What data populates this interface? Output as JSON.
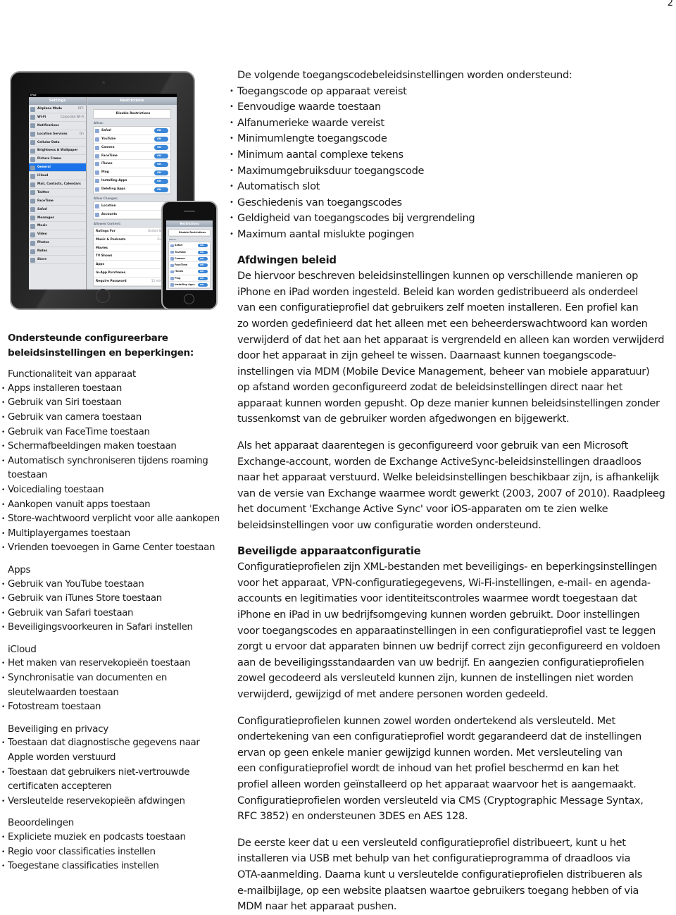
{
  "page_number": "2",
  "devices": {
    "ipad_status": "iPad",
    "sidebar_title": "Settings",
    "sidebar_items": [
      {
        "label": "Airplane Mode",
        "value": "OFF"
      },
      {
        "label": "Wi-Fi",
        "value": "Corporate Wi-Fi"
      },
      {
        "label": "Notifications",
        "value": ""
      },
      {
        "label": "Location Services",
        "value": "On"
      },
      {
        "label": "Cellular Data",
        "value": ""
      },
      {
        "label": "Brightness & Wallpaper",
        "value": ""
      },
      {
        "label": "Picture Frame",
        "value": ""
      },
      {
        "label": "General",
        "value": ""
      },
      {
        "label": "iCloud",
        "value": ""
      },
      {
        "label": "Mail, Contacts, Calendars",
        "value": ""
      },
      {
        "label": "Twitter",
        "value": ""
      },
      {
        "label": "FaceTime",
        "value": ""
      },
      {
        "label": "Safari",
        "value": ""
      },
      {
        "label": "Messages",
        "value": ""
      },
      {
        "label": "Music",
        "value": ""
      },
      {
        "label": "Video",
        "value": ""
      },
      {
        "label": "Photos",
        "value": ""
      },
      {
        "label": "Notes",
        "value": ""
      },
      {
        "label": "Store",
        "value": ""
      }
    ],
    "selected_item": "General",
    "detail_back": "General",
    "detail_title": "Restrictions",
    "disable_button": "Disable Restrictions",
    "allow_label": "Allow:",
    "allow_items": [
      "Safari",
      "YouTube",
      "Camera",
      "FaceTime",
      "iTunes",
      "Ping",
      "Installing Apps",
      "Deleting Apps"
    ],
    "toggle_on": "ON",
    "allow_changes_label": "Allow Changes:",
    "allow_changes_items": [
      "Location",
      "Accounts"
    ],
    "allowed_content_label": "Allowed Content:",
    "content_items": [
      {
        "label": "Ratings For",
        "value": "United States"
      },
      {
        "label": "Music & Podcasts",
        "value": "Explicit"
      },
      {
        "label": "Movies",
        "value": ""
      },
      {
        "label": "TV Shows",
        "value": ""
      },
      {
        "label": "Apps",
        "value": ""
      },
      {
        "label": "In-App Purchases",
        "value": "ON"
      },
      {
        "label": "Require Password",
        "value": "15 minutes"
      }
    ],
    "iphone_items": [
      "Safari",
      "YouTube",
      "Camera",
      "FaceTime",
      "iTunes",
      "Ping",
      "Installing Apps"
    ]
  },
  "left": {
    "heading": [
      "Ondersteunde configureerbare",
      "beleidsinstellingen en beperkingen:"
    ],
    "sections": [
      {
        "title": "Functionaliteit van apparaat",
        "items": [
          [
            "Apps installeren toestaan"
          ],
          [
            "Gebruik van Siri toestaan"
          ],
          [
            "Gebruik van camera toestaan"
          ],
          [
            "Gebruik van FaceTime toestaan"
          ],
          [
            "Schermafbeeldingen maken toestaan"
          ],
          [
            "Automatisch synchroniseren tijdens roaming",
            "toestaan"
          ],
          [
            "Voicedialing toestaan"
          ],
          [
            "Aankopen vanuit apps toestaan"
          ],
          [
            "Store-wachtwoord verplicht voor alle aankopen"
          ],
          [
            "Multiplayergames toestaan"
          ],
          [
            "Vrienden toevoegen in Game Center toestaan"
          ]
        ]
      },
      {
        "title": "Apps",
        "items": [
          [
            "Gebruik van YouTube toestaan"
          ],
          [
            "Gebruik van iTunes Store toestaan"
          ],
          [
            "Gebruik van Safari toestaan"
          ],
          [
            "Beveiligingsvoorkeuren in Safari instellen"
          ]
        ]
      },
      {
        "title": "iCloud",
        "items": [
          [
            "Het maken van reservekopieën toestaan"
          ],
          [
            "Synchronisatie van documenten en",
            "sleutelwaarden toestaan"
          ],
          [
            "Fotostream toestaan"
          ]
        ]
      },
      {
        "title": "Beveiliging en privacy",
        "items": [
          [
            "Toestaan dat diagnostische gegevens naar",
            "Apple worden verstuurd"
          ],
          [
            "Toestaan dat gebruikers niet-vertrouwde",
            "certificaten accepteren"
          ],
          [
            "Versleutelde reservekopieën afdwingen"
          ]
        ]
      },
      {
        "title": "Beoordelingen",
        "items": [
          [
            "Expliciete muziek en podcasts toestaan"
          ],
          [
            "Regio voor classificaties instellen"
          ],
          [
            "Toegestane classificaties instellen"
          ]
        ]
      }
    ]
  },
  "right": {
    "intro": "De volgende toegangscodebeleidsinstellingen worden ondersteund:",
    "passcode_items": [
      "Toegangscode op apparaat vereist",
      "Eenvoudige waarde toestaan",
      "Alfanumerieke waarde vereist",
      "Minimumlengte toegangscode",
      "Minimum aantal complexe tekens",
      "Maximumgebruiksduur toegangscode",
      "Automatisch slot",
      "Geschiedenis van toegangscodes",
      "Geldigheid van toegangscodes bij vergrendeling",
      "Maximum aantal mislukte pogingen"
    ],
    "sections": [
      {
        "title": "Afdwingen beleid",
        "paragraphs": [
          [
            "De hiervoor beschreven beleidsinstellingen kunnen op verschillende manieren op",
            "iPhone en iPad worden ingesteld. Beleid kan worden gedistribueerd als onderdeel",
            "van een configuratieprofiel dat gebruikers zelf moeten installeren. Een profiel kan",
            "zo worden gedefinieerd dat het alleen met een beheerderswachtwoord kan worden",
            "verwijderd of dat het aan het apparaat is vergrendeld en alleen kan worden verwijderd",
            "door het apparaat in zijn geheel te wissen. Daarnaast kunnen toegangscode-",
            "instellingen via MDM (Mobile Device Management, beheer van mobiele apparatuur)",
            "op afstand worden geconfigureerd zodat de beleidsinstellingen direct naar het",
            "apparaat kunnen worden gepusht. Op deze manier kunnen beleidsinstellingen zonder",
            "tussenkomst van de gebruiker worden afgedwongen en bijgewerkt."
          ],
          [
            "Als het apparaat daarentegen is geconfigureerd voor gebruik van een Microsoft",
            "Exchange-account, worden de Exchange ActiveSync-beleidsinstellingen draadloos",
            "naar het apparaat verstuurd. Welke beleidsinstellingen beschikbaar zijn, is afhankelijk",
            "van de versie van Exchange waarmee wordt gewerkt (2003, 2007 of 2010). Raadpleeg",
            "het document 'Exchange Active Sync' voor iOS-apparaten om te zien welke",
            "beleidsinstellingen voor uw configuratie worden ondersteund."
          ]
        ]
      },
      {
        "title": "Beveiligde apparaatconfiguratie",
        "paragraphs": [
          [
            "Configuratieprofielen zijn XML-bestanden met beveiligings- en beperkingsinstellingen",
            "voor het apparaat, VPN-configuratiegegevens, Wi-Fi-instellingen, e-mail- en agenda-",
            "accounts en legitimaties voor identiteitscontroles waarmee wordt toegestaan dat",
            "iPhone en iPad in uw bedrijfsomgeving kunnen worden gebruikt. Door instellingen",
            "voor toegangscodes en apparaatinstellingen in een configuratieprofiel vast te leggen",
            "zorgt u ervoor dat apparaten binnen uw bedrijf correct zijn geconfigureerd en voldoen",
            "aan de beveiligingsstandaarden van uw bedrijf. En aangezien configuratieprofielen",
            "zowel gecodeerd als versleuteld kunnen zijn, kunnen de instellingen niet worden",
            "verwijderd, gewijzigd of met andere personen worden gedeeld."
          ],
          [
            "Configuratieprofielen kunnen zowel worden ondertekend als versleuteld. Met",
            "ondertekening van een configuratieprofiel wordt gegarandeerd dat de instellingen",
            "ervan op geen enkele manier gewijzigd kunnen worden. Met versleuteling van",
            "een configuratieprofiel wordt de inhoud van het profiel beschermd en kan het",
            "profiel alleen worden geïnstalleerd op het apparaat waarvoor het is aangemaakt.",
            "Configuratieprofielen worden versleuteld via CMS (Cryptographic Message Syntax,",
            "RFC 3852) en ondersteunen 3DES en AES 128."
          ],
          [
            "De eerste keer dat u een versleuteld configuratieprofiel distribueert, kunt u het",
            "installeren via USB met behulp van het configuratieprogramma of draadloos via",
            "OTA-aanmelding. Daarna kunt u versleutelde configuratieprofielen distribueren als",
            "e-mailbijlage, op een website plaatsen waartoe gebruikers toegang hebben of via",
            "MDM naar het apparaat pushen."
          ]
        ]
      }
    ]
  }
}
